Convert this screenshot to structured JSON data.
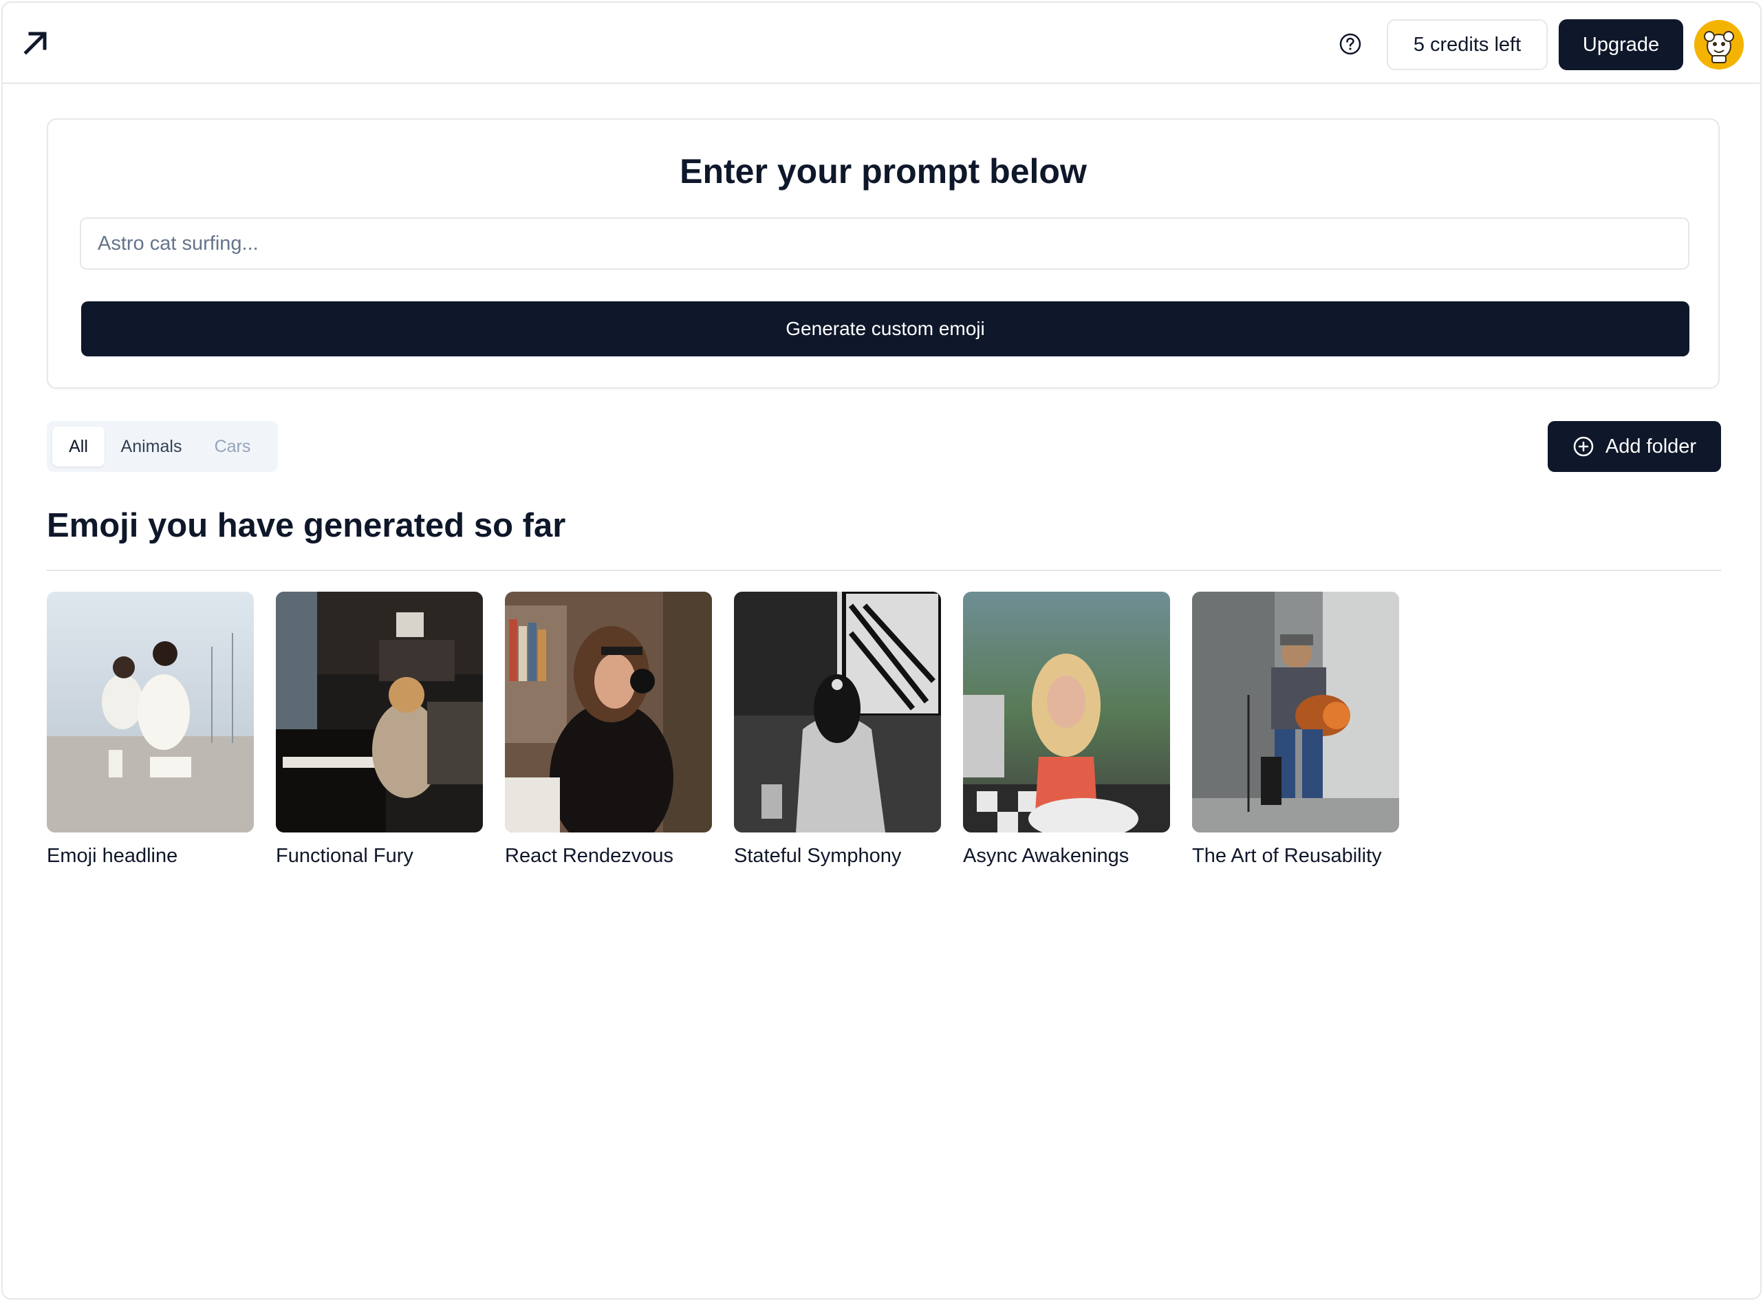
{
  "header": {
    "logo_icon": "arrow-up-right-icon",
    "help_icon": "question-circle-icon",
    "credits_label": "5 credits left",
    "upgrade_label": "Upgrade"
  },
  "prompt": {
    "title": "Enter your prompt below",
    "placeholder": "Astro cat surfing...",
    "value": "",
    "generate_label": "Generate custom emoji"
  },
  "tabs": [
    {
      "label": "All",
      "active": true
    },
    {
      "label": "Animals",
      "active": false
    },
    {
      "label": "Cars",
      "active": false
    }
  ],
  "add_folder": {
    "label": "Add folder",
    "icon": "plus-circle-icon"
  },
  "gallery": {
    "title": "Emoji you have generated so far",
    "items": [
      {
        "caption": "Emoji headline"
      },
      {
        "caption": "Functional Fury"
      },
      {
        "caption": "React Rendezvous"
      },
      {
        "caption": "Stateful Symphony"
      },
      {
        "caption": "Async Awakenings"
      },
      {
        "caption": "The Art of Reusability"
      }
    ]
  },
  "colors": {
    "primary": "#0f172a",
    "border": "#e5e7eb",
    "avatar_bg": "#f5b301",
    "muted_text": "#94a3b8"
  }
}
